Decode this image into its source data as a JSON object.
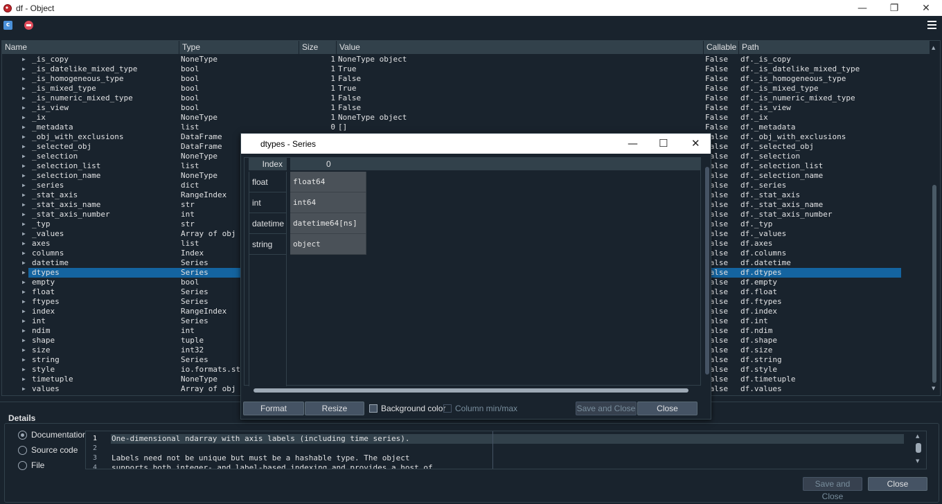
{
  "window": {
    "title": "df - Object",
    "minimize": "—",
    "maximize": "❐",
    "close": "✕"
  },
  "table": {
    "columns": [
      "Name",
      "Type",
      "Size",
      "Value",
      "Callable",
      "Path"
    ],
    "rows": [
      {
        "name": "_is_copy",
        "type": "NoneType",
        "size": "1",
        "value": "NoneType object",
        "callable": "False",
        "path": "df._is_copy"
      },
      {
        "name": "_is_datelike_mixed_type",
        "type": "bool",
        "size": "1",
        "value": "True",
        "callable": "False",
        "path": "df._is_datelike_mixed_type"
      },
      {
        "name": "_is_homogeneous_type",
        "type": "bool",
        "size": "1",
        "value": "False",
        "callable": "False",
        "path": "df._is_homogeneous_type"
      },
      {
        "name": "_is_mixed_type",
        "type": "bool",
        "size": "1",
        "value": "True",
        "callable": "False",
        "path": "df._is_mixed_type"
      },
      {
        "name": "_is_numeric_mixed_type",
        "type": "bool",
        "size": "1",
        "value": "False",
        "callable": "False",
        "path": "df._is_numeric_mixed_type"
      },
      {
        "name": "_is_view",
        "type": "bool",
        "size": "1",
        "value": "False",
        "callable": "False",
        "path": "df._is_view"
      },
      {
        "name": "_ix",
        "type": "NoneType",
        "size": "1",
        "value": "NoneType object",
        "callable": "False",
        "path": "df._ix"
      },
      {
        "name": "_metadata",
        "type": "list",
        "size": "0",
        "value": "[]",
        "callable": "False",
        "path": "df._metadata"
      },
      {
        "name": "_obj_with_exclusions",
        "type": "DataFrame",
        "size": "",
        "value": "",
        "callable": "False",
        "path": "df._obj_with_exclusions"
      },
      {
        "name": "_selected_obj",
        "type": "DataFrame",
        "size": "",
        "value": "",
        "callable": "False",
        "path": "df._selected_obj"
      },
      {
        "name": "_selection",
        "type": "NoneType",
        "size": "",
        "value": "",
        "callable": "False",
        "path": "df._selection"
      },
      {
        "name": "_selection_list",
        "type": "list",
        "size": "",
        "value": "",
        "callable": "False",
        "path": "df._selection_list"
      },
      {
        "name": "_selection_name",
        "type": "NoneType",
        "size": "",
        "value": "",
        "callable": "False",
        "path": "df._selection_name"
      },
      {
        "name": "_series",
        "type": "dict",
        "size": "",
        "value": "",
        "callable": "False",
        "path": "df._series"
      },
      {
        "name": "_stat_axis",
        "type": "RangeIndex",
        "size": "",
        "value": "",
        "callable": "False",
        "path": "df._stat_axis"
      },
      {
        "name": "_stat_axis_name",
        "type": "str",
        "size": "",
        "value": "",
        "callable": "False",
        "path": "df._stat_axis_name"
      },
      {
        "name": "_stat_axis_number",
        "type": "int",
        "size": "",
        "value": "",
        "callable": "False",
        "path": "df._stat_axis_number"
      },
      {
        "name": "_typ",
        "type": "str",
        "size": "",
        "value": "",
        "callable": "False",
        "path": "df._typ"
      },
      {
        "name": "_values",
        "type": "Array of obj",
        "size": "",
        "value": "",
        "callable": "False",
        "path": "df._values"
      },
      {
        "name": "axes",
        "type": "list",
        "size": "",
        "value": "",
        "callable": "False",
        "path": "df.axes"
      },
      {
        "name": "columns",
        "type": "Index",
        "size": "",
        "value": "",
        "callable": "False",
        "path": "df.columns"
      },
      {
        "name": "datetime",
        "type": "Series",
        "size": "",
        "value": "",
        "callable": "False",
        "path": "df.datetime"
      },
      {
        "name": "dtypes",
        "type": "Series",
        "size": "",
        "value": "",
        "callable": "False",
        "path": "df.dtypes",
        "selected": true
      },
      {
        "name": "empty",
        "type": "bool",
        "size": "",
        "value": "",
        "callable": "False",
        "path": "df.empty"
      },
      {
        "name": "float",
        "type": "Series",
        "size": "",
        "value": "",
        "callable": "False",
        "path": "df.float"
      },
      {
        "name": "ftypes",
        "type": "Series",
        "size": "",
        "value": "",
        "callable": "False",
        "path": "df.ftypes"
      },
      {
        "name": "index",
        "type": "RangeIndex",
        "size": "",
        "value": "",
        "callable": "False",
        "path": "df.index"
      },
      {
        "name": "int",
        "type": "Series",
        "size": "",
        "value": "",
        "callable": "False",
        "path": "df.int"
      },
      {
        "name": "ndim",
        "type": "int",
        "size": "",
        "value": "",
        "callable": "False",
        "path": "df.ndim"
      },
      {
        "name": "shape",
        "type": "tuple",
        "size": "",
        "value": "",
        "callable": "False",
        "path": "df.shape"
      },
      {
        "name": "size",
        "type": "int32",
        "size": "",
        "value": "",
        "callable": "False",
        "path": "df.size"
      },
      {
        "name": "string",
        "type": "Series",
        "size": "",
        "value": "",
        "callable": "False",
        "path": "df.string"
      },
      {
        "name": "style",
        "type": "io.formats.st",
        "size": "",
        "value": "",
        "callable": "False",
        "path": "df.style"
      },
      {
        "name": "timetuple",
        "type": "NoneType",
        "size": "",
        "value": "",
        "callable": "False",
        "path": "df.timetuple"
      },
      {
        "name": "values",
        "type": "Array of obj",
        "size": "",
        "value": "",
        "callable": "False",
        "path": "df.values"
      }
    ]
  },
  "details": {
    "title": "Details",
    "radios": [
      {
        "label": "Documentation",
        "checked": true
      },
      {
        "label": "Source code",
        "checked": false
      },
      {
        "label": "File",
        "checked": false
      }
    ],
    "lines": [
      {
        "num": "1",
        "text": "One-dimensional ndarray with axis labels (including time series)."
      },
      {
        "num": "2",
        "text": ""
      },
      {
        "num": "3",
        "text": "Labels need not be unique but must be a hashable type. The object"
      },
      {
        "num": "4",
        "text": "supports both integer- and label-based indexing and provides a host of"
      }
    ],
    "save_close": "Save and Close",
    "close": "Close"
  },
  "dialog": {
    "title": "dtypes - Series",
    "index_header": "Index",
    "column_header": "0",
    "index": [
      "float",
      "int",
      "datetime",
      "string"
    ],
    "values": [
      "float64",
      "int64",
      "datetime64[ns]",
      "object"
    ],
    "format": "Format",
    "resize": "Resize",
    "background_color": "Background color",
    "background_checked": true,
    "column_minmax": "Column min/max",
    "save_close": "Save and Close",
    "close": "Close"
  },
  "colors": {
    "background": "#19232d",
    "header": "#32414b",
    "selection": "#1464a0",
    "button": "#455364"
  }
}
